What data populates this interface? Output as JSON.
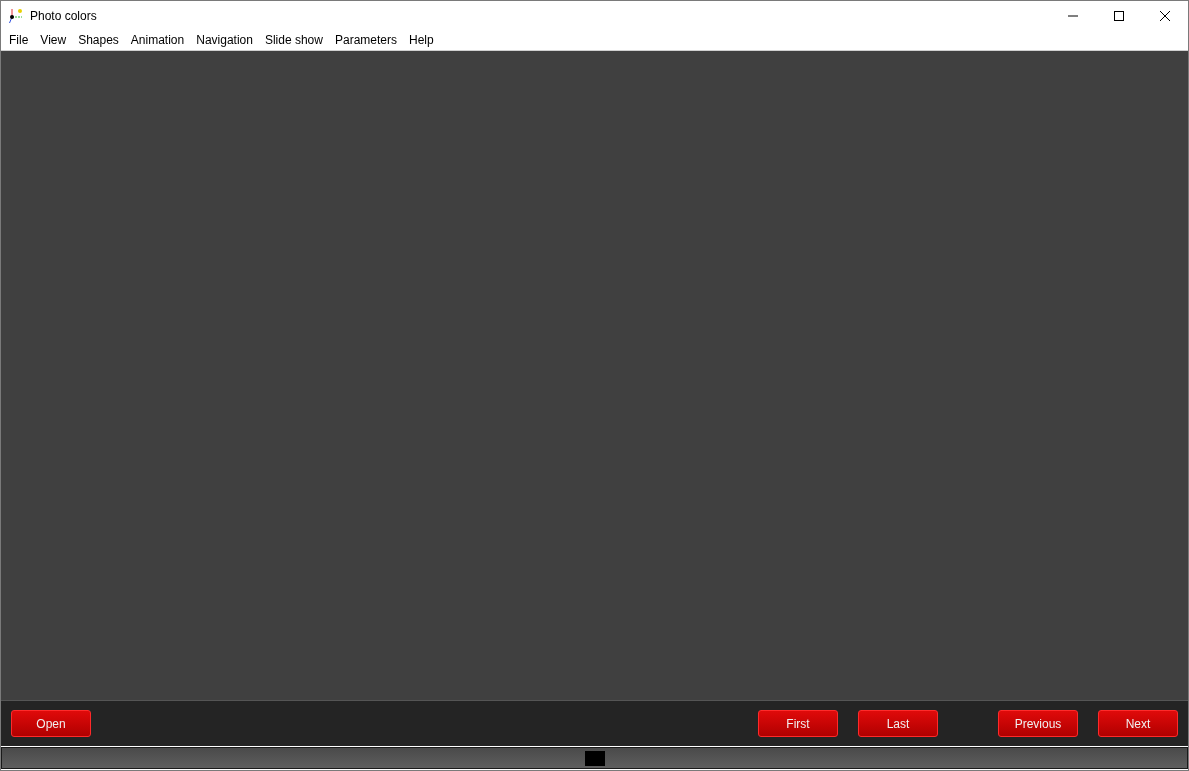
{
  "window": {
    "title": "Photo colors"
  },
  "menu": [
    "File",
    "View",
    "Shapes",
    "Animation",
    "Navigation",
    "Slide show",
    "Parameters",
    "Help"
  ],
  "button_groups": [
    [
      "Open"
    ],
    [
      "First",
      "Last"
    ],
    [
      "Previous",
      "Next"
    ]
  ]
}
